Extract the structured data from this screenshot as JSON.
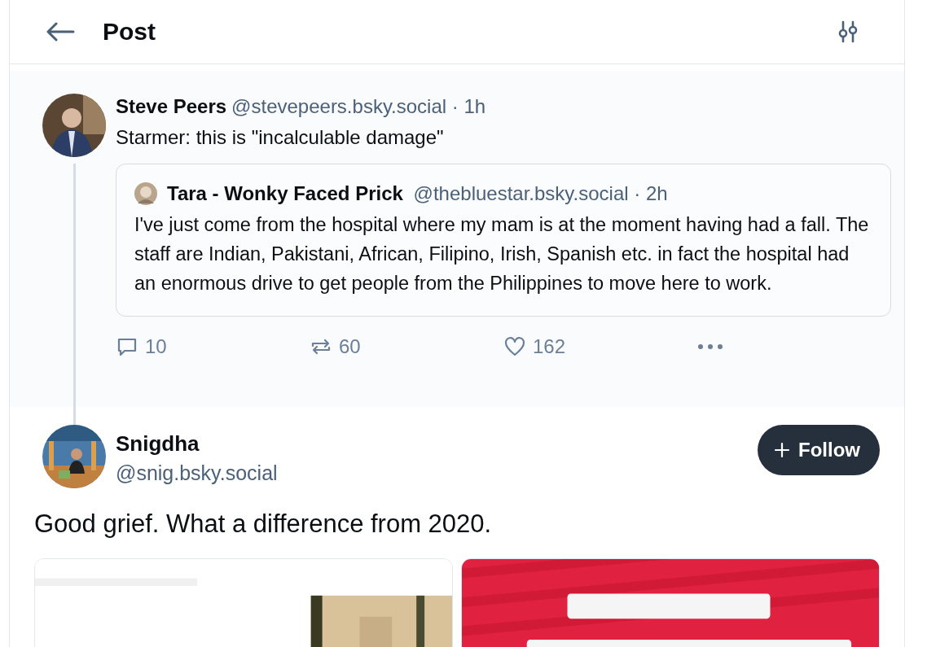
{
  "header": {
    "title": "Post"
  },
  "parent_post": {
    "author": "Steve Peers",
    "handle": "@stevepeers.bsky.social · 1h",
    "text": "Starmer: this is \"incalculable damage\"",
    "quote": {
      "author": "Tara - Wonky Faced Prick",
      "handle": "@thebluestar.bsky.social · 2h",
      "text": "I've just come from the hospital where my mam is at the moment having had a fall. The staff are Indian, Pakistani, African, Filipino, Irish, Spanish etc. in fact the hospital had an enormous drive to get people from the Philippines to move here to work."
    },
    "actions": [
      {
        "kind": "reply",
        "count": "10"
      },
      {
        "kind": "repost",
        "count": "60"
      },
      {
        "kind": "like",
        "count": "162"
      },
      {
        "kind": "more"
      }
    ]
  },
  "main_post": {
    "author": "Snigdha",
    "handle": "@snig.bsky.social",
    "follow_label": "Follow",
    "text": "Good grief. What a difference from 2020."
  }
}
